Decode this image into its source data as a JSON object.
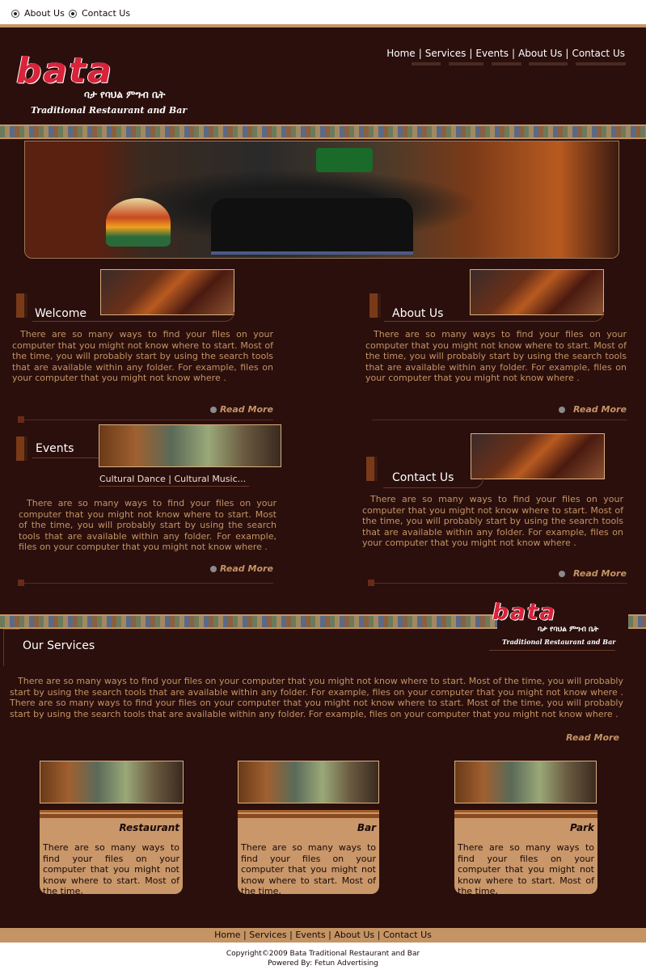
{
  "top_links": [
    "About Us",
    "Contact Us"
  ],
  "logo": {
    "mark": "bata",
    "amharic": "ባታ የባህል ምግብ ቤት",
    "subtitle": "Traditional Restaurant and Bar"
  },
  "nav": [
    "Home",
    "Services",
    "Events",
    "About Us",
    "Contact Us"
  ],
  "sections": {
    "welcome": {
      "title": "Welcome",
      "text": "There are so many ways to find your files on your computer that you might not know where to start. Most of the time, you will probably start by using the search tools that are available within any folder. For example,  files on your computer that you might not know where .",
      "read_more": "Read More"
    },
    "about": {
      "title": "About Us",
      "text": "There are so many ways to find your files on your computer that you might not know where to start. Most of the time, you will probably start by using the search tools that are available within any folder. For example,  files on your computer that you might not know where .",
      "read_more": "Read More"
    },
    "events": {
      "title": "Events",
      "caption": "Cultural Dance | Cultural Music...",
      "text": "There are so many ways to find your files on your computer that you might not know where to start. Most of the time, you will probably start by using the search tools that are available within any folder. For example,  files on your computer that you might not know where .",
      "read_more": "Read More"
    },
    "contact": {
      "title": "Contact Us",
      "text": "There are so many ways to find your files on your computer that you might not know where to start. Most of the time, you will probably start by using the search tools that are available within any folder. For example,  files on your computer that you might not know where .",
      "read_more": "Read More"
    }
  },
  "services": {
    "title": "Our Services",
    "text": "There are so many ways to find your files on your computer that you might not know where to start. Most of the time, you will probably start by using the search tools that are available within any folder. For example,  files on your computer that you might not know where .   There are so many ways to find your files on your computer that you might not know where to start. Most of the time, you will probably start by using the search tools that are available within any folder. For example,  files on your computer that you might not know where .",
    "read_more": "Read More",
    "cards": [
      {
        "title": "Restaurant",
        "text": "There are so many ways to find your files on your computer that you might not know where to start. Most of the time,"
      },
      {
        "title": "Bar",
        "text": "There are so many ways to find your files on your computer that you might not know where to start. Most of the time,"
      },
      {
        "title": "Park",
        "text": "There are so many ways to find your files on your computer that you might not know where to start. Most of the time,"
      }
    ]
  },
  "footer": {
    "links": [
      "Home",
      "Services",
      "Events",
      "About Us",
      "Contact Us"
    ],
    "copyright": "Copyright©2009 Bata Traditional Restaurant and Bar",
    "powered": "Powered By: Fetun Advertising"
  },
  "colors": {
    "background": "#2a0f0c",
    "accent": "#c49464",
    "logo_red": "#d8233a"
  }
}
